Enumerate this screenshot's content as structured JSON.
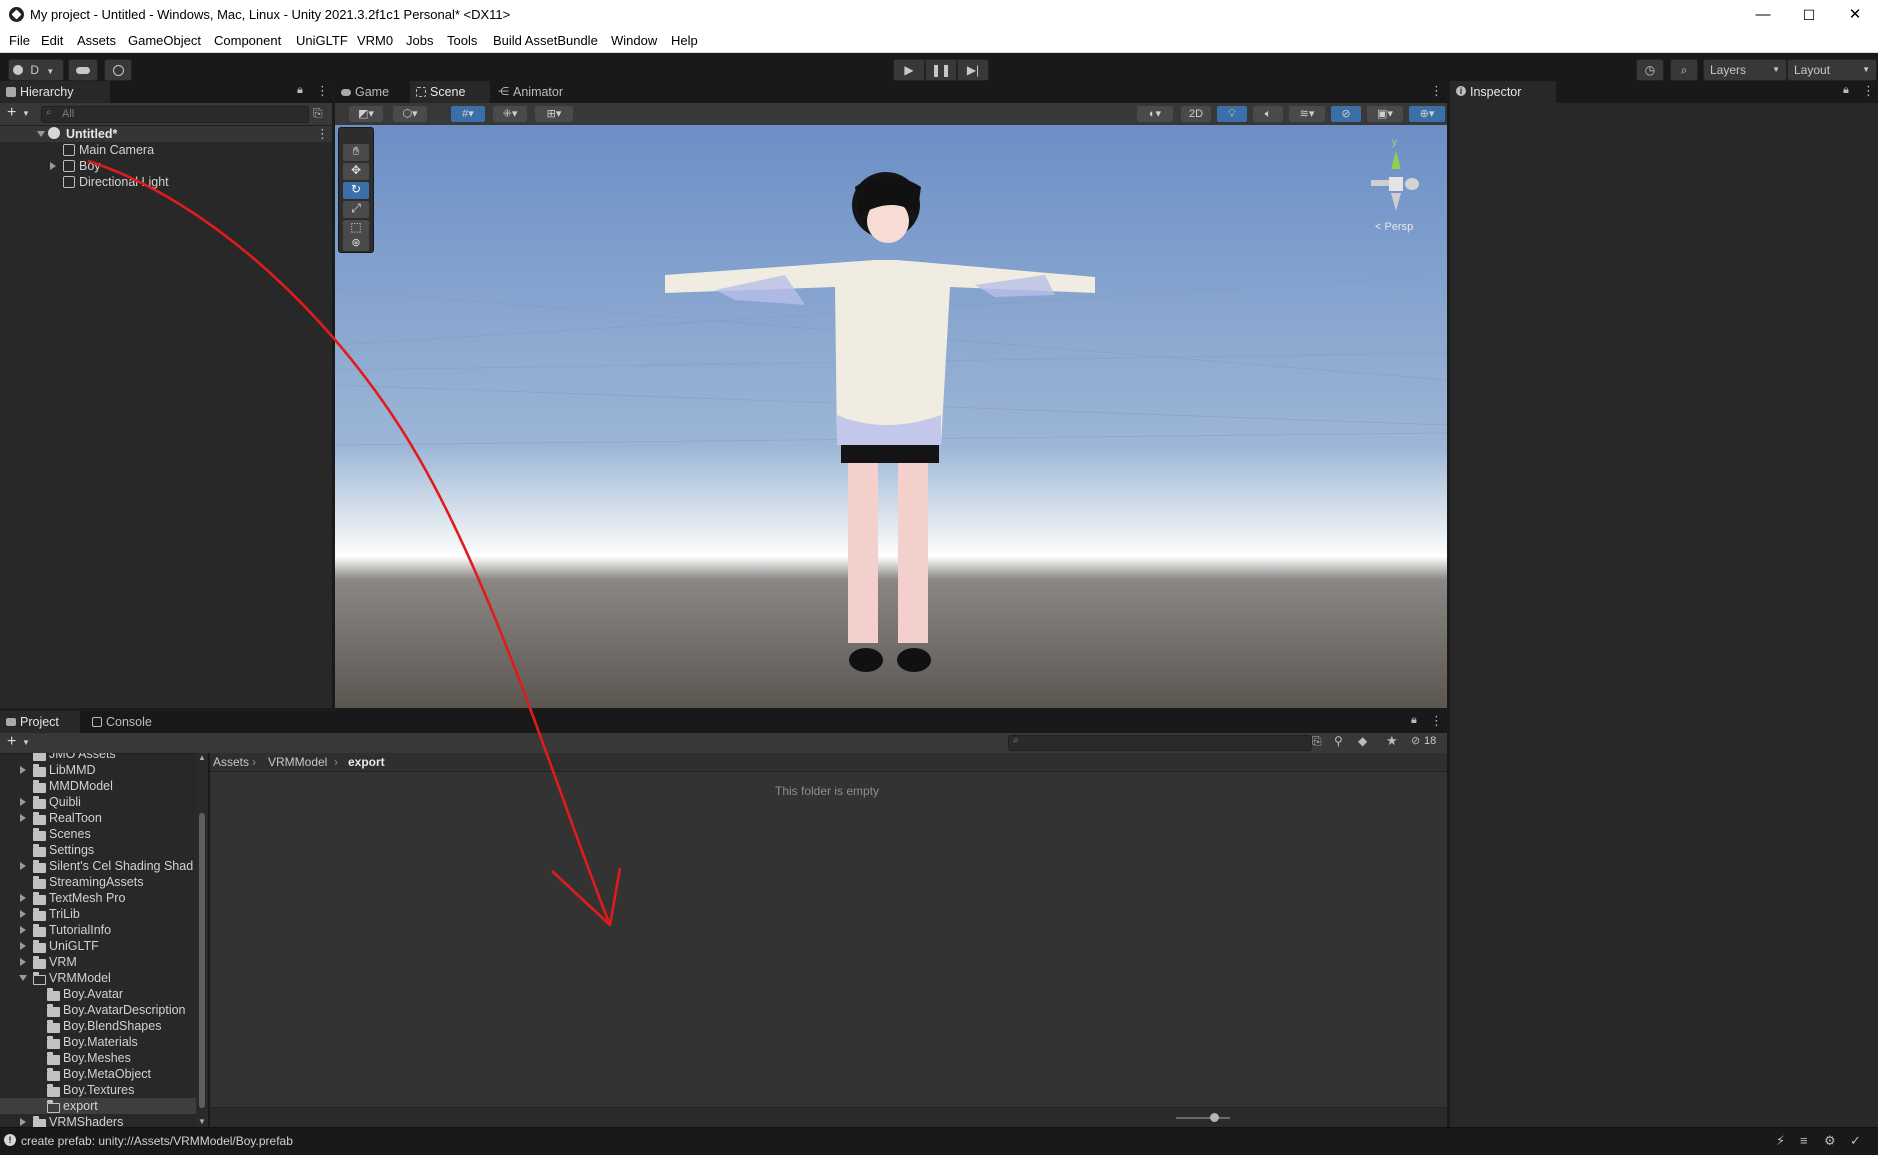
{
  "window": {
    "title": "My project - Untitled - Windows, Mac, Linux - Unity 2021.3.2f1c1 Personal* <DX11>",
    "minimize": "—",
    "maximize": "☐",
    "close": "✕"
  },
  "menu": [
    "File",
    "Edit",
    "Assets",
    "GameObject",
    "Component",
    "UniGLTF",
    "VRM0",
    "Jobs",
    "Tools",
    "Build AssetBundle",
    "Window",
    "Help"
  ],
  "toolbar": {
    "account_label": "D",
    "layers_label": "Layers",
    "layout_label": "Layout"
  },
  "hierarchy": {
    "tab_label": "Hierarchy",
    "search_placeholder": "All",
    "scene_name": "Untitled*",
    "items": [
      "Main Camera",
      "Boy",
      "Directional Light"
    ]
  },
  "center_tabs": [
    "Game",
    "Scene",
    "Animator"
  ],
  "scene_toolbar": {
    "mode_2d": "2D"
  },
  "gizmo": {
    "axis_y": "y",
    "projection": "< Persp"
  },
  "inspector": {
    "tab_label": "Inspector"
  },
  "bottom_tabs": [
    "Project",
    "Console"
  ],
  "project": {
    "breadcrumb": [
      "Assets",
      "VRMModel",
      "export"
    ],
    "empty_message": "This folder is empty",
    "hidden_count": "18",
    "tree": [
      {
        "label": "JMO Assets",
        "arrow": "none",
        "indent": 0
      },
      {
        "label": "LibMMD",
        "arrow": "right",
        "indent": 0
      },
      {
        "label": "MMDModel",
        "arrow": "none",
        "indent": 0
      },
      {
        "label": "Quibli",
        "arrow": "right",
        "indent": 0
      },
      {
        "label": "RealToon",
        "arrow": "right",
        "indent": 0
      },
      {
        "label": "Scenes",
        "arrow": "none",
        "indent": 0
      },
      {
        "label": "Settings",
        "arrow": "none",
        "indent": 0
      },
      {
        "label": "Silent's Cel Shading Shad",
        "arrow": "right",
        "indent": 0
      },
      {
        "label": "StreamingAssets",
        "arrow": "none",
        "indent": 0
      },
      {
        "label": "TextMesh Pro",
        "arrow": "right",
        "indent": 0
      },
      {
        "label": "TriLib",
        "arrow": "right",
        "indent": 0
      },
      {
        "label": "TutorialInfo",
        "arrow": "right",
        "indent": 0
      },
      {
        "label": "UniGLTF",
        "arrow": "right",
        "indent": 0
      },
      {
        "label": "VRM",
        "arrow": "right",
        "indent": 0
      },
      {
        "label": "VRMModel",
        "arrow": "down",
        "indent": 0
      },
      {
        "label": "Boy.Avatar",
        "arrow": "none",
        "indent": 1
      },
      {
        "label": "Boy.AvatarDescription",
        "arrow": "none",
        "indent": 1
      },
      {
        "label": "Boy.BlendShapes",
        "arrow": "none",
        "indent": 1
      },
      {
        "label": "Boy.Materials",
        "arrow": "none",
        "indent": 1
      },
      {
        "label": "Boy.Meshes",
        "arrow": "none",
        "indent": 1
      },
      {
        "label": "Boy.MetaObject",
        "arrow": "none",
        "indent": 1
      },
      {
        "label": "Boy.Textures",
        "arrow": "none",
        "indent": 1
      },
      {
        "label": "export",
        "arrow": "none",
        "indent": 1,
        "selected": true
      },
      {
        "label": "VRMShaders",
        "arrow": "right",
        "indent": 0
      }
    ]
  },
  "status_bar": {
    "message": "create prefab: unity://Assets/VRMModel/Boy.prefab"
  },
  "colors": {
    "annotation_arrow": "#e11b1b",
    "active_tool": "#3a6fa8"
  }
}
